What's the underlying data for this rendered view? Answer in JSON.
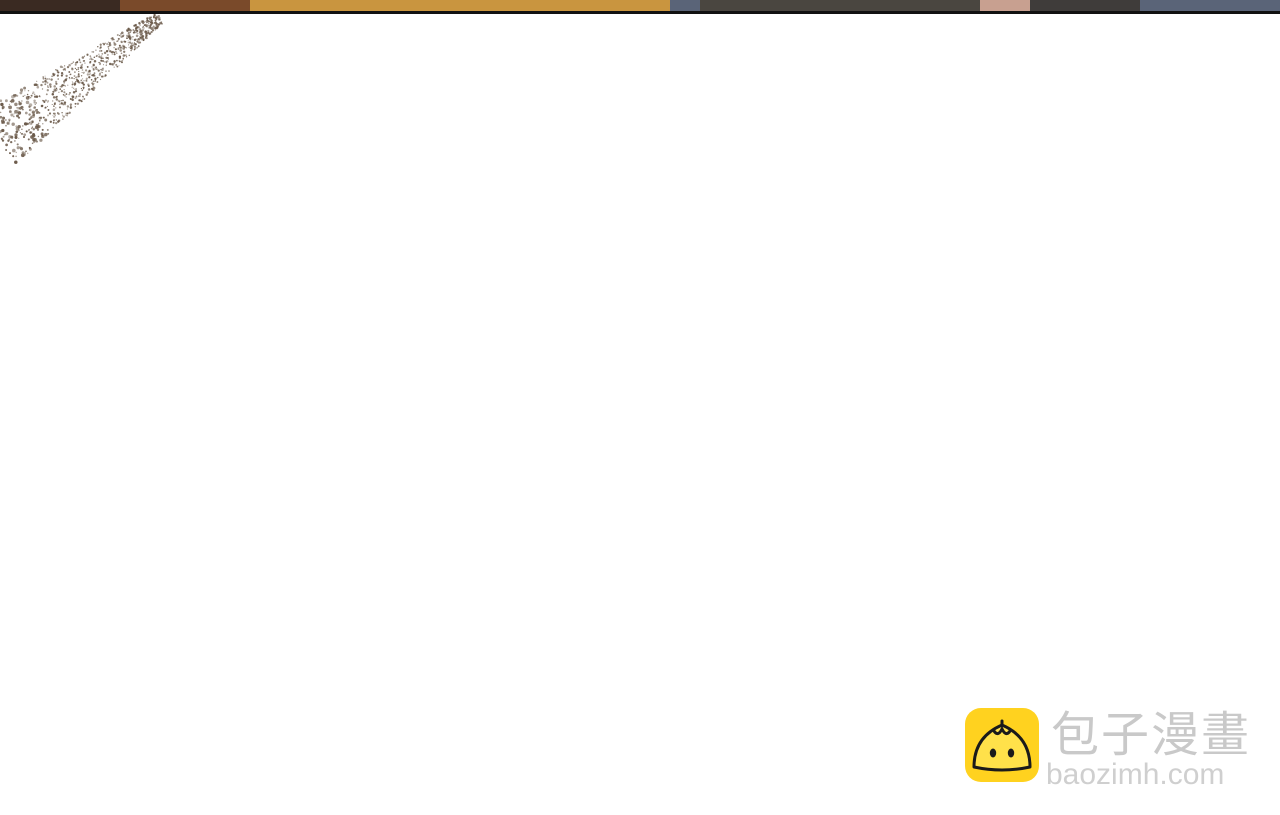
{
  "panel": {
    "background": "#ffffff",
    "top_strip_colors": [
      "#3a2a22",
      "#7a4a2a",
      "#b8863c",
      "#d4a55a",
      "#4a4640",
      "#3a4860",
      "#c8a090",
      "#5a6478"
    ],
    "border_color": "#111111"
  },
  "effects": {
    "dust_color": "#6b5a4a",
    "dust_icon": "speckle-dust"
  },
  "watermark": {
    "icon": "steamed-bun-icon",
    "icon_bg": "#ffd21f",
    "brand_cn": "包子漫畫",
    "brand_url": "baozimh.com",
    "text_color": "#c9c9c9"
  }
}
